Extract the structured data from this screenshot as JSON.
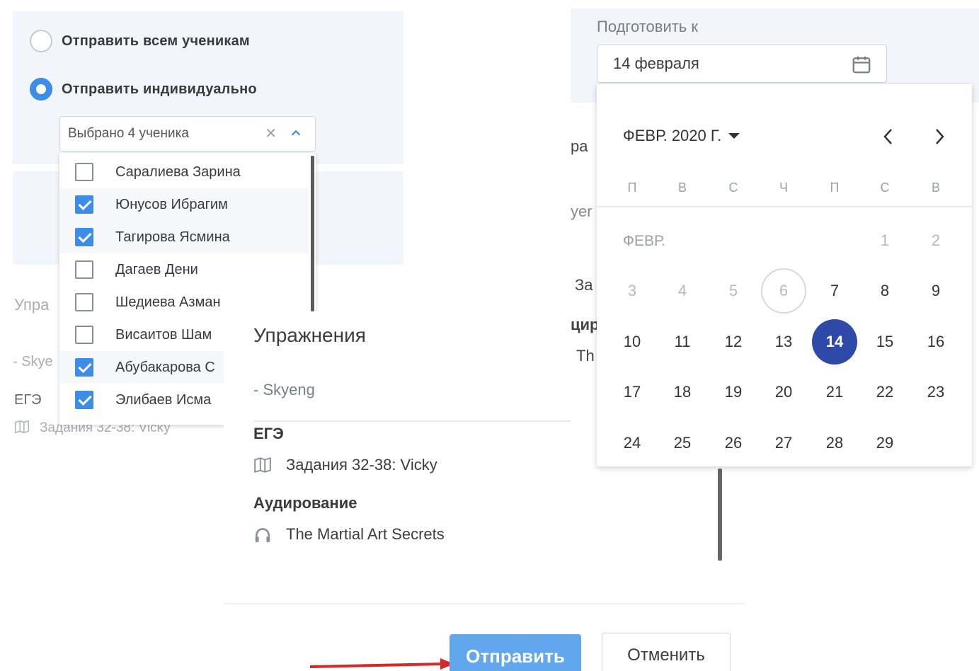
{
  "recipients": {
    "option_all_label": "Отправить всем ученикам",
    "option_individual_label": "Отправить индивидуально",
    "selected_option": "individual",
    "select_value": "Выбрано 4 ученика",
    "students": [
      {
        "name": "Саралиева Зарина",
        "checked": false
      },
      {
        "name": "Юнусов Ибрагим",
        "checked": true
      },
      {
        "name": "Тагирова Ясмина",
        "checked": true
      },
      {
        "name": "Дагаев Дени",
        "checked": false
      },
      {
        "name": "Шедиева Азман",
        "checked": false
      },
      {
        "name": "Висаитов Шам",
        "checked": false
      },
      {
        "name": "Абубакарова С",
        "checked": true
      },
      {
        "name": "Элибаев Исма",
        "checked": true
      }
    ],
    "bg_text": {
      "upra": "Упра",
      "skye": "- Skye",
      "ege": "ЕГЭ",
      "task": "Задания 32-38: Vicky"
    }
  },
  "exercises": {
    "title": "Упражнения",
    "source": "- Skyeng",
    "sections": [
      {
        "name": "ЕГЭ",
        "item": "Задания 32-38: Vicky",
        "icon": "book-icon"
      },
      {
        "name": "Аудирование",
        "item": "The Martial Art Secrets",
        "icon": "headphones-icon"
      }
    ]
  },
  "deadline": {
    "label": "Подготовить к",
    "value": "14 февраля",
    "behind_text": {
      "a": "ра",
      "b": "yer",
      "c": "За",
      "d": "цир",
      "e": "Th"
    }
  },
  "calendar": {
    "header": "ФЕВР. 2020 Г.",
    "month_short": "ФЕВР.",
    "weekdays": [
      "П",
      "В",
      "С",
      "Ч",
      "П",
      "С",
      "В"
    ],
    "weeks": [
      [
        "",
        "",
        "",
        "",
        "",
        "1",
        "2"
      ],
      [
        "3",
        "4",
        "5",
        "6",
        "7",
        "8",
        "9"
      ],
      [
        "10",
        "11",
        "12",
        "13",
        "14",
        "15",
        "16"
      ],
      [
        "17",
        "18",
        "19",
        "20",
        "21",
        "22",
        "23"
      ],
      [
        "24",
        "25",
        "26",
        "27",
        "28",
        "29",
        ""
      ]
    ],
    "today": "6",
    "selected": "14",
    "accent_color": "#2f49a8"
  },
  "actions": {
    "send_label": "Отправить",
    "cancel_label": "Отменить"
  }
}
